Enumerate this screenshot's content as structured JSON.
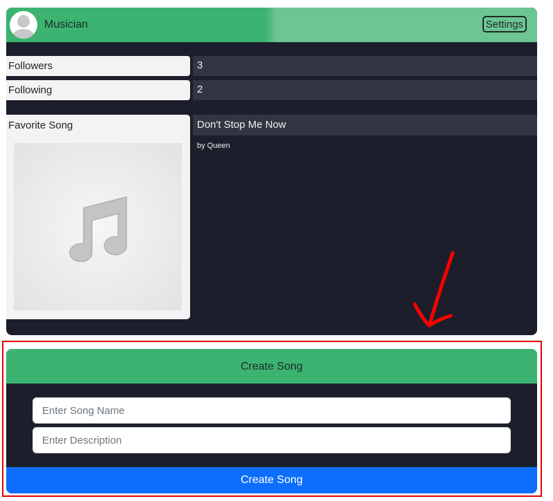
{
  "profile": {
    "username": "Musician",
    "settings_label": "Settings",
    "stats": [
      {
        "label": "Followers",
        "value": "3"
      },
      {
        "label": "Following",
        "value": "2"
      }
    ],
    "favorite_song": {
      "label": "Favorite Song",
      "title": "Don't Stop Me Now",
      "artist": "by Queen",
      "art_icon": "music-note-icon"
    }
  },
  "create_song": {
    "header": "Create Song",
    "song_name_placeholder": "Enter Song Name",
    "description_placeholder": "Enter Description",
    "submit_label": "Create Song"
  },
  "annotation": {
    "highlight_color": "#e00000",
    "arrow_icon": "hand-drawn-arrow-icon"
  },
  "colors": {
    "green": "#3cb371",
    "light_green": "#6cc593",
    "dark_bg": "#1c1f2b",
    "value_bg": "#323542",
    "primary_blue": "#0d6efd"
  }
}
